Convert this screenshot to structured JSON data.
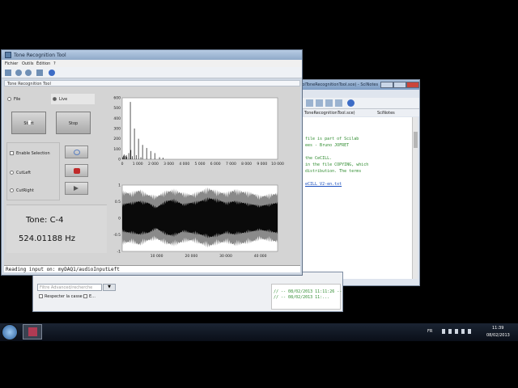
{
  "scinotes": {
    "title": "ToolToneRecognitionTool.sce) - SciNotes",
    "tab_label": "ToneRecognitionTool.sce)",
    "tab2_label": "SciNotes",
    "code_lines": [
      "file is part of Scilab",
      "ees - Bruno JOFRET",
      "",
      "the CeCILL.",
      "in the file COPYING, which",
      "distribution.  The terms"
    ],
    "link_text": "eCILL_V2-en.txt"
  },
  "console": {
    "search_placeholder": "Filtre Advanced/recherche",
    "case_checkbox": "Respecter la casse",
    "regex_checkbox": "E...",
    "history_lines": [
      "// -- 08/02/2013 11:11:26 --",
      "// -- 08/02/2013 11:..."
    ]
  },
  "main": {
    "title": "Tone Recognition Tool",
    "menus": [
      "Fichier",
      "Outils",
      "Édition",
      "?"
    ],
    "panel_title": "Tone Recognition Tool",
    "radio_file": "File",
    "radio_live": "Live",
    "start_button": "Start",
    "stop_button": "Stop",
    "enable_selection": "Enable Selection",
    "cut_left": "CutLeft",
    "cut_right": "CutRight",
    "tone_label": "Tone: C-4",
    "frequency_label": "524.01188 Hz",
    "status": "Reading input on: myDAQ1/audioInputLeft"
  },
  "chart_data": [
    {
      "type": "bar",
      "title": "",
      "xlabel": "",
      "ylabel": "",
      "xlim": [
        0,
        10000
      ],
      "ylim": [
        0,
        600
      ],
      "xticks": [
        "0",
        "1 000",
        "2 000",
        "3 000",
        "4 000",
        "5 000",
        "6 000",
        "7 000",
        "8 000",
        "9 000",
        "10 000"
      ],
      "yticks": [
        "0",
        "100",
        "200",
        "300",
        "400",
        "500",
        "600"
      ],
      "x": [
        30,
        80,
        130,
        200,
        262,
        300,
        420,
        524,
        560,
        650,
        786,
        900,
        1048,
        1200,
        1310,
        1572,
        1834,
        2096,
        2400,
        2620
      ],
      "values": [
        20,
        35,
        45,
        30,
        40,
        25,
        60,
        560,
        90,
        30,
        300,
        40,
        200,
        20,
        140,
        110,
        80,
        60,
        20,
        15
      ]
    },
    {
      "type": "area",
      "title": "",
      "xlabel": "",
      "ylabel": "",
      "xlim": [
        0,
        45000
      ],
      "ylim": [
        -1,
        1
      ],
      "xticks": [
        "10 000",
        "20 000",
        "30 000",
        "40 000"
      ],
      "yticks": [
        "-1",
        "-0.5",
        "0",
        "0.5",
        "1"
      ],
      "description_free": true,
      "envelope_x": [
        0,
        2500,
        5000,
        7500,
        10000,
        12500,
        15000,
        17500,
        20000,
        22500,
        25000,
        27500,
        30000,
        32500,
        35000,
        37500,
        40000,
        42500,
        45000
      ],
      "envelope_gray": [
        0.85,
        0.8,
        0.9,
        0.75,
        0.7,
        0.85,
        0.9,
        0.8,
        0.75,
        0.85,
        0.95,
        0.85,
        0.8,
        0.9,
        0.85,
        0.8,
        0.7,
        0.75,
        0.8
      ],
      "envelope_black": [
        0.45,
        0.5,
        0.55,
        0.5,
        0.35,
        0.55,
        0.6,
        0.45,
        0.5,
        0.55,
        0.65,
        0.6,
        0.5,
        0.55,
        0.5,
        0.45,
        0.4,
        0.45,
        0.5
      ]
    }
  ],
  "taskbar": {
    "lang": "FR",
    "time": "11:39",
    "date": "08/02/2013"
  }
}
